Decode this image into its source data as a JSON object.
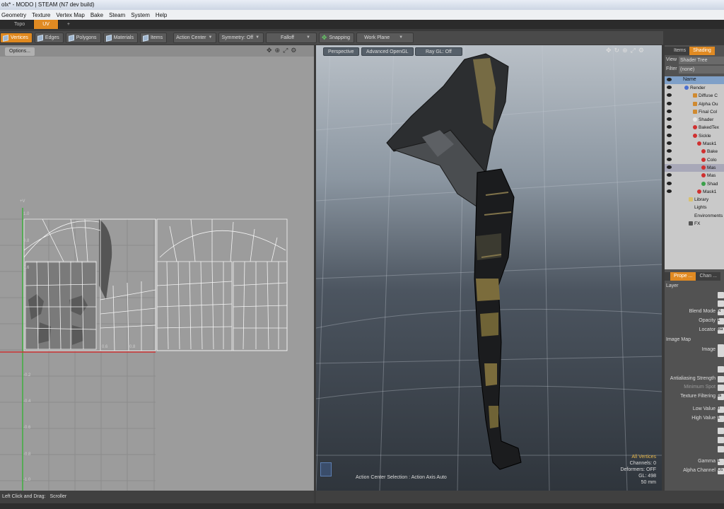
{
  "window": {
    "title": "olx* - MODO | STEAM (N7 dev build)"
  },
  "menu": [
    "Geometry",
    "Texture",
    "Vertex Map",
    "Bake",
    "Steam",
    "System",
    "Help"
  ],
  "tabs": [
    {
      "label": "Topo",
      "active": false
    },
    {
      "label": "UV",
      "active": true
    },
    {
      "label": "+",
      "active": false
    }
  ],
  "toolbar": {
    "vertices": "Vertices",
    "edges": "Edges",
    "polygons": "Polygons",
    "materials": "Materials",
    "items": "Items",
    "action_center": "Action Center",
    "symmetry": "Symmetry: Off",
    "falloff": "Falloff",
    "snapping": "Snapping",
    "work_plane": "Work Plane"
  },
  "uv_view": {
    "options": "Options...",
    "axis_v": "+V",
    "ticks_v": [
      "1.0",
      "0.8",
      "0.6",
      "-0.2",
      "-0.4",
      "-0.6",
      "-0.8",
      "-1.0"
    ],
    "ticks_u": [
      "0.6",
      "0.8"
    ]
  },
  "viewport": {
    "perspective": "Perspective",
    "opengl": "Advanced OpenGL",
    "raygl": "Ray GL: Off",
    "info_header": "All Vertices",
    "info_lines": [
      "Channels: 0",
      "Deformers: OFF",
      "GL: 498",
      "50 mm"
    ],
    "action_center_status": "Action Center Selection : Action Axis Auto"
  },
  "status": {
    "mouse": "Left Click and Drag:",
    "action": "Scroller"
  },
  "shader_panel": {
    "tab_items": "Items",
    "tab_shading": "Shading",
    "view_label": "View",
    "view_value": "Shader Tree",
    "filter_label": "Filter",
    "filter_value": "(none)",
    "name_header": "Name",
    "tree": [
      {
        "label": "Render",
        "indent": 0,
        "icon": "sphere-blue"
      },
      {
        "label": "Diffuse C",
        "indent": 2,
        "icon": "box-orange"
      },
      {
        "label": "Alpha Ou",
        "indent": 2,
        "icon": "box-orange"
      },
      {
        "label": "Final Col",
        "indent": 2,
        "icon": "box-orange"
      },
      {
        "label": "Shader",
        "indent": 2,
        "icon": "sphere-white"
      },
      {
        "label": "BakedTex",
        "indent": 2,
        "icon": "sphere-red"
      },
      {
        "label": "Sickle",
        "indent": 2,
        "icon": "sphere-red"
      },
      {
        "label": "Mask1",
        "indent": 3,
        "icon": "sphere-red"
      },
      {
        "label": "Bake",
        "indent": 4,
        "icon": "sphere-red"
      },
      {
        "label": "Colo",
        "indent": 4,
        "icon": "sphere-red"
      },
      {
        "label": "Mas",
        "indent": 4,
        "icon": "sphere-red"
      },
      {
        "label": "Mas",
        "indent": 4,
        "icon": "sphere-red"
      },
      {
        "label": "Shad",
        "indent": 4,
        "icon": "sphere-green"
      },
      {
        "label": "Mask1",
        "indent": 3,
        "icon": "sphere-red"
      },
      {
        "label": "Library",
        "indent": 1,
        "icon": "folder"
      },
      {
        "label": "Lights",
        "indent": 1,
        "icon": "none"
      },
      {
        "label": "Environments",
        "indent": 1,
        "icon": "none"
      },
      {
        "label": "FX",
        "indent": 1,
        "icon": "film"
      }
    ]
  },
  "properties": {
    "tab_props": "Prope ...",
    "tab_chan": "Chan ...",
    "section_layer": "Layer",
    "blend_mode": "Blend Mode",
    "blend_value": "N",
    "opacity": "Opacity",
    "opacity_value": "1",
    "locator": "Locator",
    "locator_value": "Ba",
    "section_image": "Image Map",
    "image": "Image",
    "antialias": "Antialiasing Strength",
    "min_spot": "Minimum Spot",
    "tex_filter": "Texture Filtering",
    "tex_filter_value": "Bi",
    "low_value": "Low Value",
    "low_value_value": "0",
    "high_value": "High Value",
    "high_value_value": "1",
    "gamma": "Gamma",
    "gamma_value": "1",
    "alpha_channel": "Alpha Channel",
    "alpha_channel_value": "Us"
  },
  "colors": {
    "accent": "#e08a22",
    "uv_bg": "#9c9c9c",
    "info_text": "#e8b84a"
  }
}
